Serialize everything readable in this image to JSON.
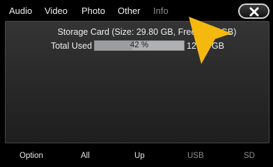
{
  "tabs": [
    {
      "label": "Audio"
    },
    {
      "label": "Video"
    },
    {
      "label": "Photo"
    },
    {
      "label": "Other"
    },
    {
      "label": "Info"
    }
  ],
  "storage": {
    "line": "Storage Card (Size: 29.80 GB, Free: 1",
    "line_tail": "GB)",
    "used_label": "Total Used",
    "used_percent_text": "42 %",
    "used_fraction": 0.42,
    "used_value_prefix": "12",
    "used_value_suffix": "GB"
  },
  "bottom": {
    "option": "Option",
    "all": "All",
    "up": "Up",
    "usb": "USB",
    "sd": "SD"
  },
  "icons": {
    "close": "close-icon",
    "pointer": "arrow-pointer-icon"
  },
  "colors": {
    "pointer": "#f5b80f",
    "bar_bg": "#aeb0b4"
  }
}
